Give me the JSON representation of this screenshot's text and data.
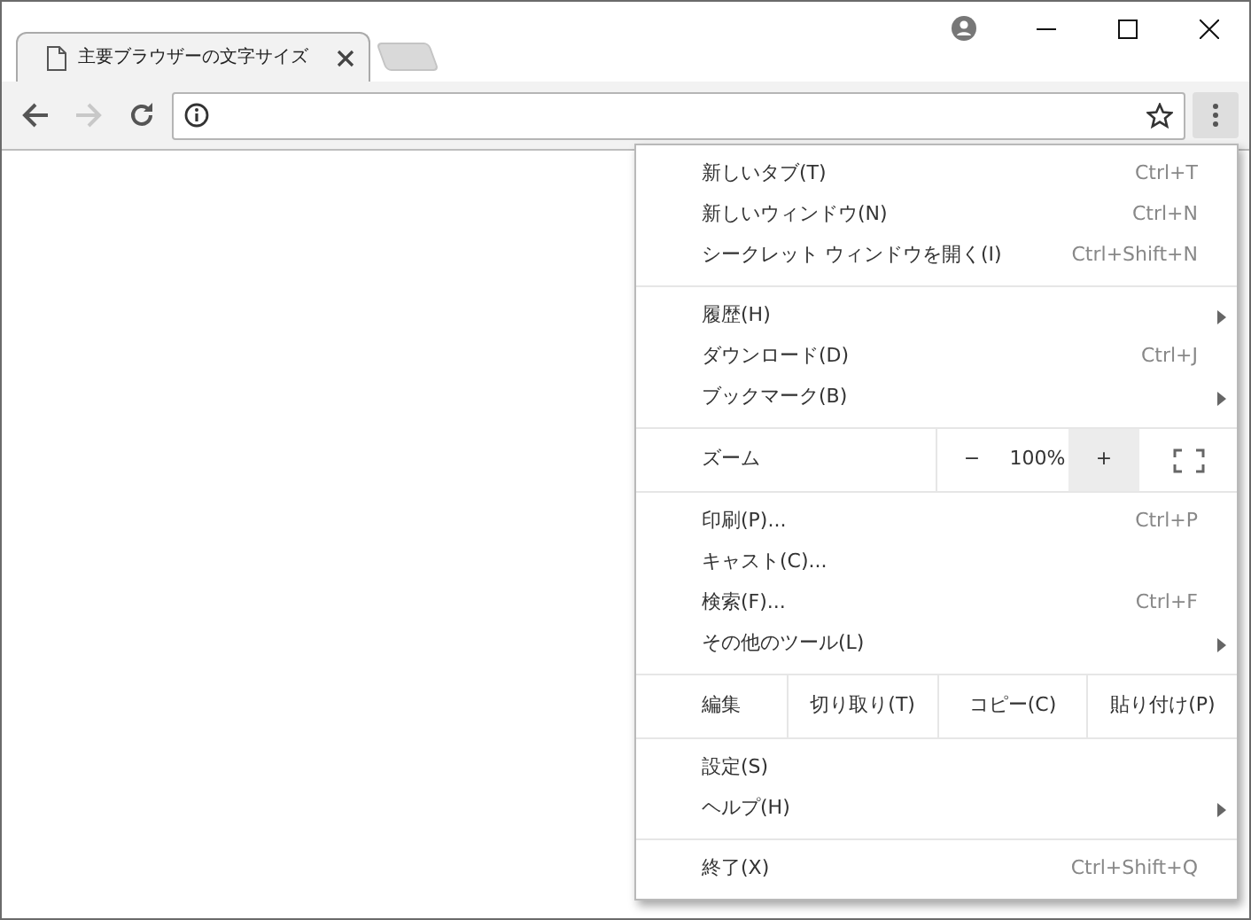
{
  "tabs": [
    {
      "title": "主要ブラウザーの文字サイズ",
      "selected": true
    }
  ],
  "toolbar": {
    "back_disabled": false,
    "forward_disabled": true
  },
  "menu": {
    "sections": [
      {
        "kind": "list",
        "items": [
          {
            "label": "新しいタブ(T)",
            "shortcut": "Ctrl+T",
            "submenu": false
          },
          {
            "label": "新しいウィンドウ(N)",
            "shortcut": "Ctrl+N",
            "submenu": false
          },
          {
            "label": "シークレット ウィンドウを開く(I)",
            "shortcut": "Ctrl+Shift+N",
            "submenu": false
          }
        ]
      },
      {
        "kind": "list",
        "items": [
          {
            "label": "履歴(H)",
            "submenu": true
          },
          {
            "label": "ダウンロード(D)",
            "shortcut": "Ctrl+J",
            "submenu": false
          },
          {
            "label": "ブックマーク(B)",
            "submenu": true
          }
        ]
      },
      {
        "kind": "zoom",
        "label": "ズーム",
        "minus": "−",
        "value": "100%",
        "plus": "+",
        "plus_highlighted": true
      },
      {
        "kind": "list",
        "items": [
          {
            "label": "印刷(P)...",
            "shortcut": "Ctrl+P",
            "submenu": false
          },
          {
            "label": "キャスト(C)...",
            "submenu": false
          },
          {
            "label": "検索(F)...",
            "shortcut": "Ctrl+F",
            "submenu": false
          },
          {
            "label": "その他のツール(L)",
            "submenu": true
          }
        ]
      },
      {
        "kind": "edit",
        "label": "編集",
        "buttons": [
          "切り取り(T)",
          "コピー(C)",
          "貼り付け(P)"
        ]
      },
      {
        "kind": "list",
        "items": [
          {
            "label": "設定(S)",
            "submenu": false
          },
          {
            "label": "ヘルプ(H)",
            "submenu": true
          }
        ]
      },
      {
        "kind": "list",
        "items": [
          {
            "label": "終了(X)",
            "shortcut": "Ctrl+Shift+Q",
            "submenu": false
          }
        ]
      }
    ]
  }
}
